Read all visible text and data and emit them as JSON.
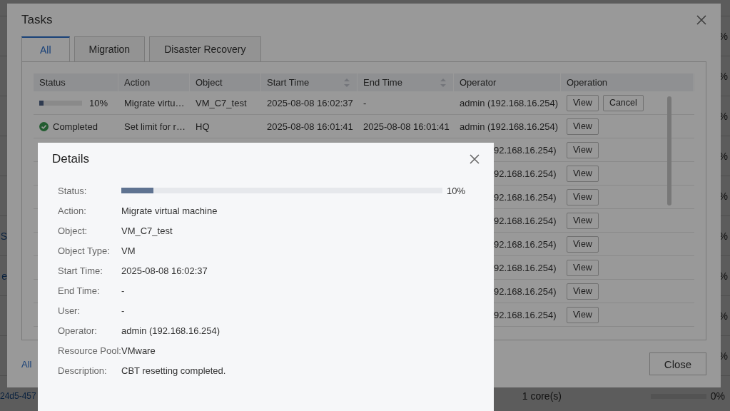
{
  "background_table": {
    "rows": [
      {
        "column_last": "%"
      },
      {
        "column_last": "%"
      },
      {
        "column_last": "%"
      },
      {
        "column_last": "%"
      },
      {
        "column_last": "%"
      },
      {
        "column_1": "S",
        "column_last": "%"
      },
      {
        "column_1": "e",
        "column_last": "%"
      },
      {
        "column_last": "%"
      },
      {
        "column_last": "%"
      }
    ],
    "bottom_row": {
      "id": "24d5-457",
      "cpu": "1 core(s)",
      "usage": "0%"
    }
  },
  "tasks_dialog": {
    "title": "Tasks",
    "tabs": [
      {
        "label": "All",
        "selected": true
      },
      {
        "label": "Migration",
        "selected": false
      },
      {
        "label": "Disaster Recovery",
        "selected": false
      }
    ],
    "columns": [
      {
        "label": "Status",
        "sortable": false
      },
      {
        "label": "Action",
        "sortable": false
      },
      {
        "label": "Object",
        "sortable": false
      },
      {
        "label": "Start Time",
        "sortable": true
      },
      {
        "label": "End Time",
        "sortable": true
      },
      {
        "label": "Operator",
        "sortable": false
      },
      {
        "label": "Operation",
        "sortable": false
      }
    ],
    "rows": [
      {
        "status": {
          "kind": "progress",
          "level": 0.1,
          "text": "10%"
        },
        "action": "Migrate virtu…",
        "object": "VM_C7_test",
        "start_time": "2025-08-08 16:02:37",
        "end_time": "-",
        "operator": "admin (192.168.16.254)",
        "operations": [
          "View",
          "Cancel"
        ]
      },
      {
        "status": {
          "kind": "completed",
          "text": "Completed"
        },
        "action": "Set limit for r…",
        "object": "HQ",
        "start_time": "2025-08-08 16:01:41",
        "end_time": "2025-08-08 16:01:41",
        "operator": "admin (192.168.16.254)",
        "operations": [
          "View"
        ]
      },
      {
        "operator": "92.168.16.254)",
        "operations": [
          "View"
        ]
      },
      {
        "operator": "92.168.16.254)",
        "operations": [
          "View"
        ]
      },
      {
        "operator": "92.168.16.254)",
        "operations": [
          "View"
        ]
      },
      {
        "operator": "92.168.16.254)",
        "operations": [
          "View"
        ]
      },
      {
        "operator": "92.168.16.254)",
        "operations": [
          "View"
        ]
      },
      {
        "operator": "92.168.16.254)",
        "operations": [
          "View"
        ]
      },
      {
        "operator": "92.168.16.254)",
        "operations": [
          "View"
        ]
      },
      {
        "operator": "92.168.16.254)",
        "operations": [
          "View"
        ]
      }
    ],
    "footer_link": "All",
    "close_button": "Close"
  },
  "details_dialog": {
    "title": "Details",
    "fields": [
      {
        "label": "Status:",
        "kind": "progress",
        "level": 0.1,
        "value": "10%"
      },
      {
        "label": "Action:",
        "value": "Migrate virtual machine"
      },
      {
        "label": "Object:",
        "value": "VM_C7_test"
      },
      {
        "label": "Object Type:",
        "value": "VM"
      },
      {
        "label": "Start Time:",
        "value": "2025-08-08 16:02:37"
      },
      {
        "label": "End Time:",
        "value": "-"
      },
      {
        "label": "User:",
        "value": "-"
      },
      {
        "label": "Operator:",
        "value": "admin (192.168.16.254)"
      },
      {
        "label": "Resource Pool:",
        "value": "VMware"
      },
      {
        "label": "Description:",
        "value": "CBT resetting completed."
      }
    ]
  }
}
